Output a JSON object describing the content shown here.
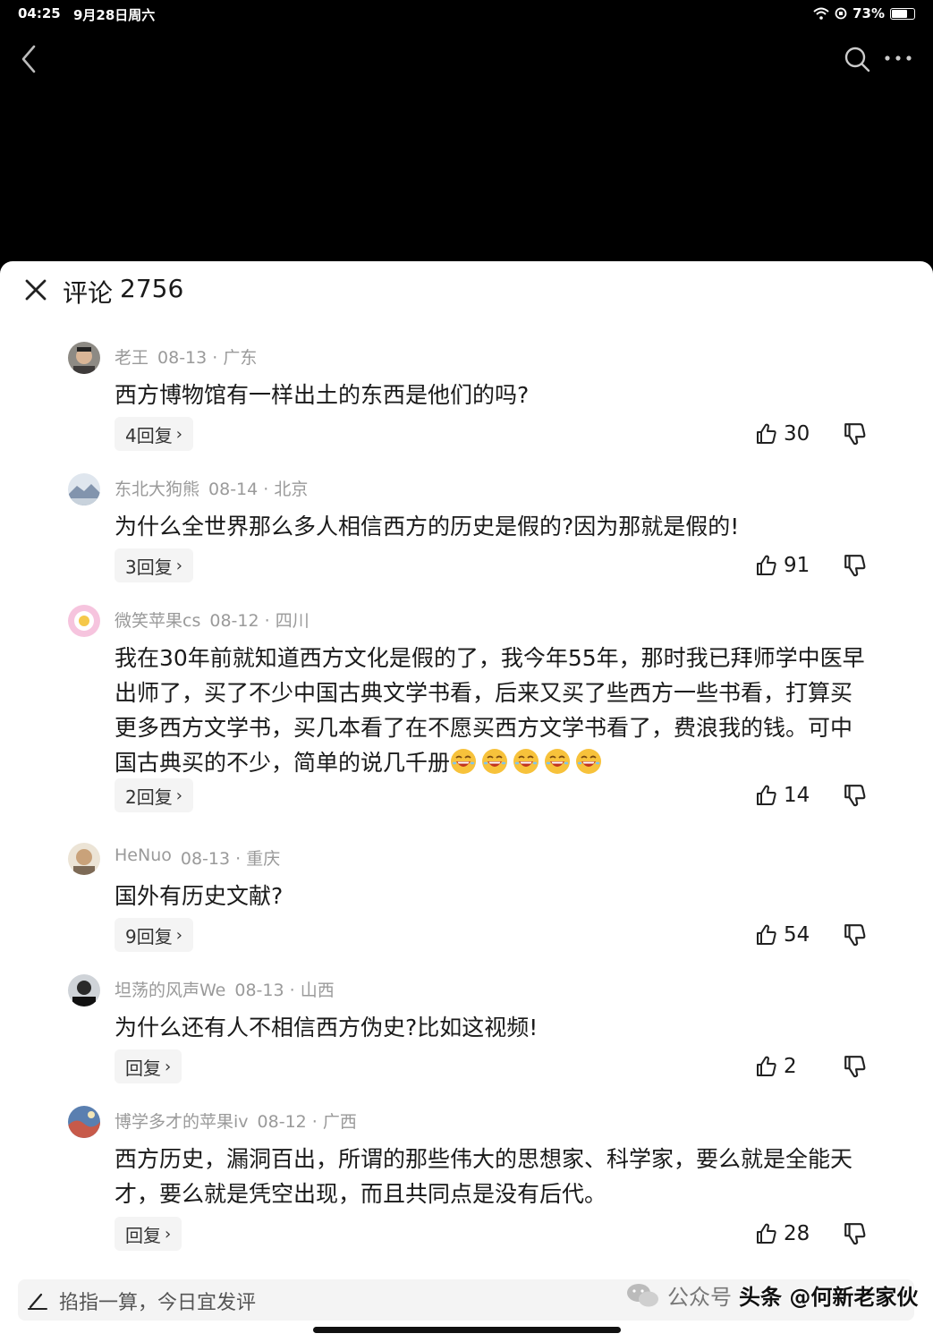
{
  "status_bar": {
    "time": "04:25",
    "date": "9月28日周六",
    "battery_text": "73%",
    "battery_level": 0.73
  },
  "icons": {
    "back": "chevron-left-icon",
    "search": "search-icon",
    "more": "more-dots-icon",
    "close": "close-icon",
    "like": "thumbs-up-icon",
    "dislike": "thumbs-down-icon",
    "pen": "pen-icon",
    "emoji": "laughing-emoji-icon",
    "wechat": "wechat-icon"
  },
  "panel": {
    "title": "评论",
    "count": "2756"
  },
  "comments": [
    {
      "author": "老王",
      "date": "08-13 · 广东",
      "text": "西方博物馆有一样出土的东西是他们的吗?",
      "reply_label": "4回复",
      "likes": "30"
    },
    {
      "author": "东北大狗熊",
      "date": "08-14 · 北京",
      "text": "为什么全世界那么多人相信西方的历史是假的?因为那就是假的!",
      "reply_label": "3回复",
      "likes": "91"
    },
    {
      "author": "微笑苹果cs",
      "date": "08-12 · 四川",
      "text": "我在30年前就知道西方文化是假的了，我今年55年，那时我已拜师学中医早出师了，买了不少中国古典文学书看，后来又买了些西方一些书看，打算买更多西方文学书，买几本看了在不愿买西方文学书看了，费浪我的钱。可中国古典买的不少，简单的说几千册",
      "emoji_count": 5,
      "reply_label": "2回复",
      "likes": "14"
    },
    {
      "author": "HeNuo",
      "date": "08-13 · 重庆",
      "text": "国外有历史文献?",
      "reply_label": "9回复",
      "likes": "54"
    },
    {
      "author": "坦荡的风声We",
      "date": "08-13 · 山西",
      "text": "为什么还有人不相信西方伪史?比如这视频!",
      "reply_label": "回复",
      "likes": "2"
    },
    {
      "author": "博学多才的苹果iv",
      "date": "08-12 · 广西",
      "text": "西方历史，漏洞百出，所谓的那些伟大的思想家、科学家，要么就是全能天才，要么就是凭空出现，而且共同点是没有后代。",
      "reply_label": "回复",
      "likes": "28"
    }
  ],
  "input": {
    "placeholder": "掐指一算，今日宜发评"
  },
  "watermark": {
    "label": "公众号",
    "author": "头条 @何新老家伙"
  },
  "colors": {
    "background_top": "#000000",
    "panel": "#ffffff",
    "meta_text": "#9a9a9a",
    "body_text": "#1a1a1a",
    "chip": "#f4f4f4"
  }
}
